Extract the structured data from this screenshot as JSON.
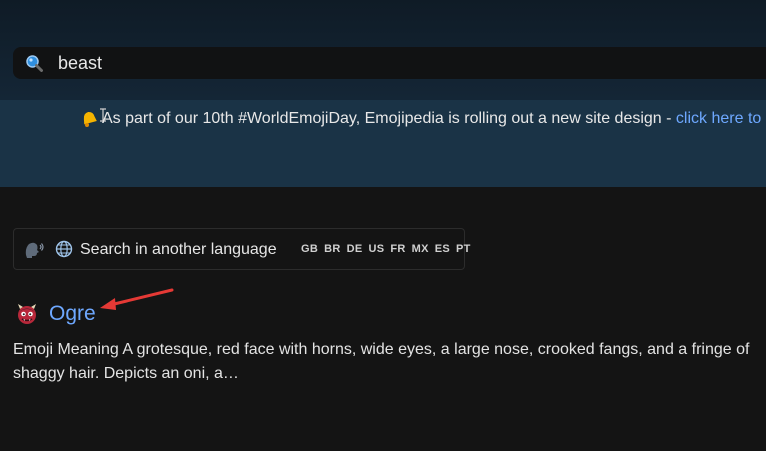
{
  "search": {
    "value": "beast"
  },
  "banner": {
    "text": "As part of our 10th #WorldEmojiDay, Emojipedia is rolling out a new site design -",
    "link": "click here to"
  },
  "language": {
    "label": "Search in another language",
    "flags": [
      "GB",
      "BR",
      "DE",
      "US",
      "FR",
      "MX",
      "ES",
      "PT"
    ]
  },
  "result": {
    "title": "Ogre",
    "description": "Emoji Meaning A grotesque, red face with horns, wide eyes, a large nose, crooked fangs, and a fringe of shaggy hair. Depicts an oni, a…"
  },
  "colors": {
    "link": "#6ea8ff",
    "annotation_arrow": "#e53935"
  }
}
